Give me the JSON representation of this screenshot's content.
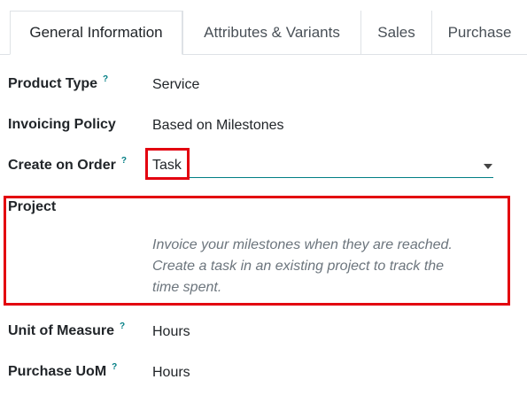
{
  "tabs": [
    {
      "label": "General Information",
      "active": true
    },
    {
      "label": "Attributes & Variants",
      "active": false
    },
    {
      "label": "Sales",
      "active": false
    },
    {
      "label": "Purchase",
      "active": false
    }
  ],
  "fields": {
    "product_type": {
      "label": "Product Type",
      "hint": "?",
      "value": "Service"
    },
    "invoicing_policy": {
      "label": "Invoicing Policy",
      "value": "Based on Milestones"
    },
    "create_on_order": {
      "label": "Create on Order",
      "hint": "?",
      "value": "Task"
    },
    "project": {
      "label": "Project"
    },
    "unit_of_measure": {
      "label": "Unit of Measure",
      "hint": "?",
      "value": "Hours"
    },
    "purchase_uom": {
      "label": "Purchase UoM",
      "hint": "?",
      "value": "Hours"
    }
  },
  "help_text": {
    "line1": "Invoice your milestones when they are reached.",
    "line2": "Create a task in an existing project to track the",
    "line3": "time spent."
  },
  "colors": {
    "accent": "#017e84",
    "highlight": "#e3000f"
  }
}
